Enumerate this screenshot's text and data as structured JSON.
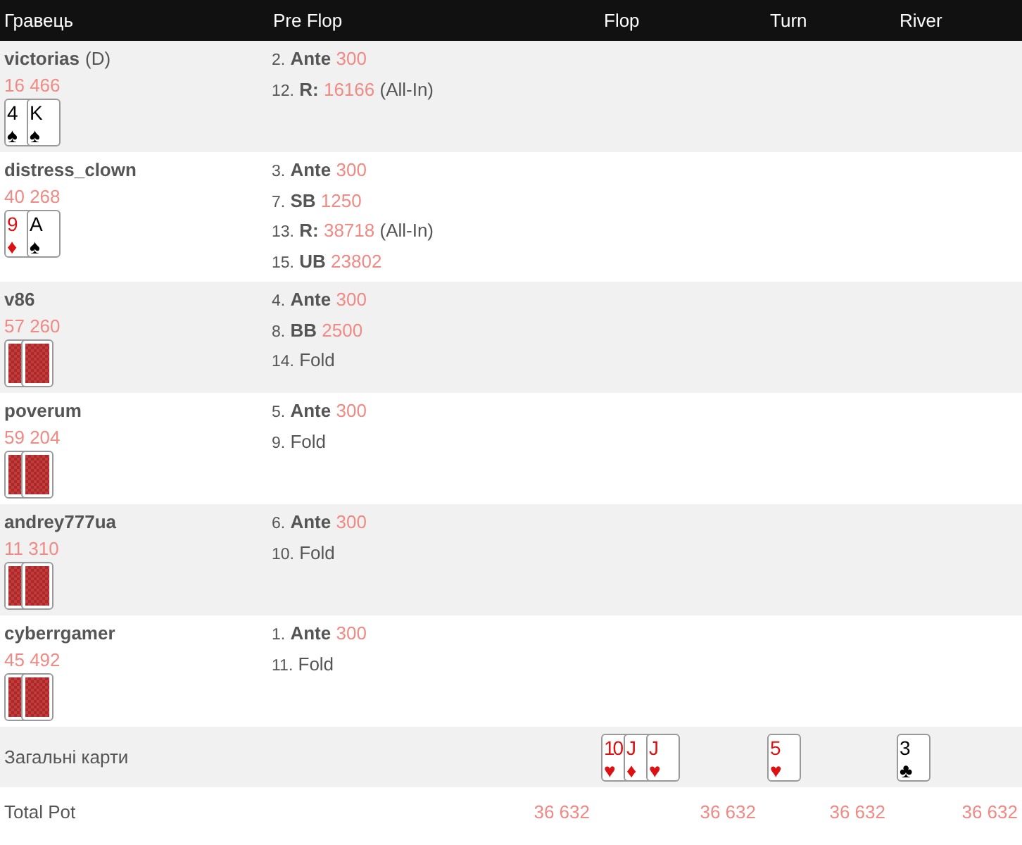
{
  "columns": [
    "Гравець",
    "Pre Flop",
    "Flop",
    "Turn",
    "River"
  ],
  "players": [
    {
      "name": "victorias",
      "dealer": "(D)",
      "stack": "16 466",
      "cards": [
        {
          "kind": "face",
          "rank": "4",
          "suit": "♠",
          "color": "#000000"
        },
        {
          "kind": "face",
          "rank": "K",
          "suit": "♠",
          "color": "#000000"
        }
      ],
      "actions": [
        {
          "kind": "bet",
          "number": "2.",
          "label": "Ante",
          "amount": "300"
        },
        {
          "kind": "bet",
          "number": "12.",
          "label": "R:",
          "amount": "16166",
          "note": "(All-In)"
        }
      ]
    },
    {
      "name": "distress_clown",
      "stack": "40 268",
      "cards": [
        {
          "kind": "face",
          "rank": "9",
          "suit": "♦",
          "color": "#dd1111"
        },
        {
          "kind": "face",
          "rank": "A",
          "suit": "♠",
          "color": "#000000"
        }
      ],
      "actions": [
        {
          "kind": "bet",
          "number": "3.",
          "label": "Ante",
          "amount": "300"
        },
        {
          "kind": "bet",
          "number": "7.",
          "label": "SB",
          "amount": "1250"
        },
        {
          "kind": "bet",
          "number": "13.",
          "label": "R:",
          "amount": "38718",
          "note": "(All-In)"
        },
        {
          "kind": "bet",
          "number": "15.",
          "label": "UB",
          "amount": "23802"
        }
      ]
    },
    {
      "name": "v86",
      "stack": "57 260",
      "cards": [
        {
          "kind": "back"
        },
        {
          "kind": "back"
        }
      ],
      "actions": [
        {
          "kind": "bet",
          "number": "4.",
          "label": "Ante",
          "amount": "300"
        },
        {
          "kind": "bet",
          "number": "8.",
          "label": "BB",
          "amount": "2500"
        },
        {
          "kind": "fold",
          "number": "14.",
          "label": "Fold"
        }
      ]
    },
    {
      "name": "poverum",
      "stack": "59 204",
      "cards": [
        {
          "kind": "back"
        },
        {
          "kind": "back"
        }
      ],
      "actions": [
        {
          "kind": "bet",
          "number": "5.",
          "label": "Ante",
          "amount": "300"
        },
        {
          "kind": "fold",
          "number": "9.",
          "label": "Fold"
        }
      ]
    },
    {
      "name": "andrey777ua",
      "stack": "11 310",
      "cards": [
        {
          "kind": "back"
        },
        {
          "kind": "back"
        }
      ],
      "actions": [
        {
          "kind": "bet",
          "number": "6.",
          "label": "Ante",
          "amount": "300"
        },
        {
          "kind": "fold",
          "number": "10.",
          "label": "Fold"
        }
      ]
    },
    {
      "name": "cyberrgamer",
      "stack": "45 492",
      "cards": [
        {
          "kind": "back"
        },
        {
          "kind": "back"
        }
      ],
      "actions": [
        {
          "kind": "bet",
          "number": "1.",
          "label": "Ante",
          "amount": "300"
        },
        {
          "kind": "fold",
          "number": "11.",
          "label": "Fold"
        }
      ]
    }
  ],
  "community": {
    "label": "Загальні карти",
    "streets": [
      [
        {
          "kind": "face",
          "rank": "10",
          "suit": "♥",
          "color": "#dd1111"
        },
        {
          "kind": "face",
          "rank": "J",
          "suit": "♦",
          "color": "#dd1111"
        },
        {
          "kind": "face",
          "rank": "J",
          "suit": "♥",
          "color": "#dd1111"
        }
      ],
      [
        {
          "kind": "face",
          "rank": "5",
          "suit": "♥",
          "color": "#dd1111"
        }
      ],
      [
        {
          "kind": "face",
          "rank": "3",
          "suit": "♣",
          "color": "#000000"
        }
      ]
    ]
  },
  "total_pot": {
    "label": "Total Pot",
    "values": [
      "36 632",
      "36 632",
      "36 632",
      "36 632"
    ]
  }
}
